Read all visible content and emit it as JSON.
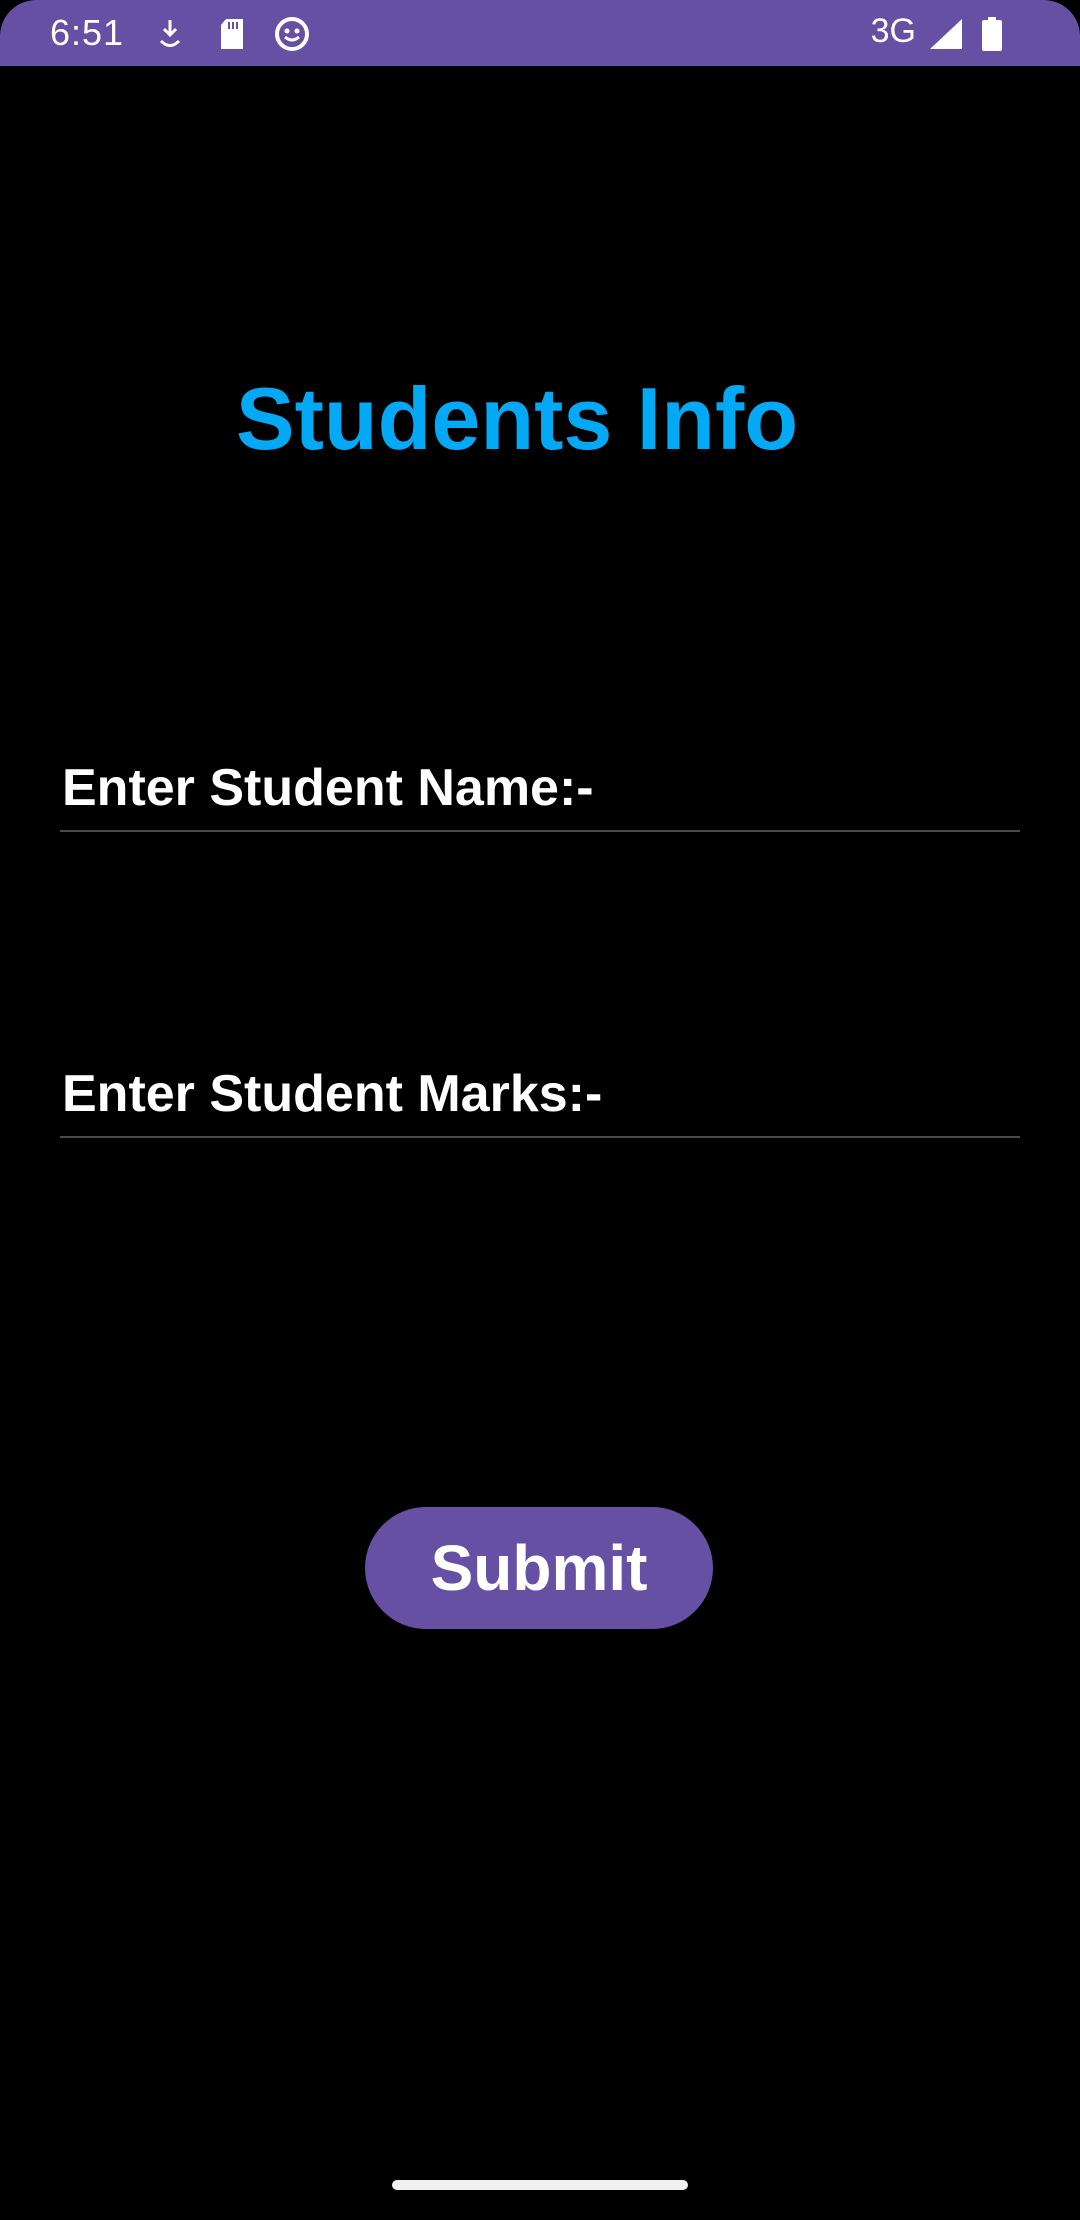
{
  "status_bar": {
    "time": "6:51",
    "network": "3G",
    "icons": [
      "download-icon",
      "sd-card-icon",
      "smiley-icon",
      "signal-icon",
      "battery-icon"
    ],
    "background_color": "#6650a4"
  },
  "page": {
    "title": "Students Info",
    "title_color": "#03a9f4"
  },
  "form": {
    "name_placeholder": "Enter Student Name:-",
    "marks_placeholder": "Enter Student Marks:-",
    "submit_label": "Submit",
    "button_color": "#6650a4"
  }
}
